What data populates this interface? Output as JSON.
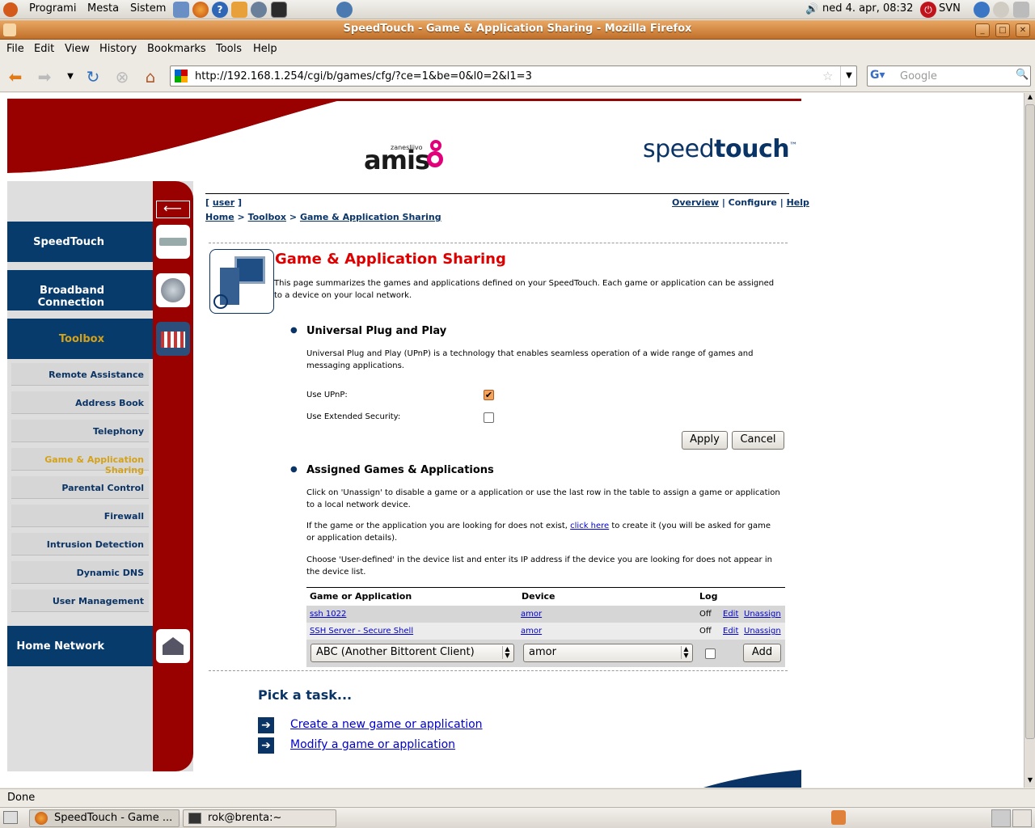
{
  "panel": {
    "menus": [
      "Programi",
      "Mesta",
      "Sistem"
    ],
    "clock": "ned  4. apr, 08:32",
    "svn": "SVN"
  },
  "window": {
    "title": "SpeedTouch - Game & Application Sharing - Mozilla Firefox"
  },
  "menubar": [
    "File",
    "Edit",
    "View",
    "History",
    "Bookmarks",
    "Tools",
    "Help"
  ],
  "toolbar": {
    "url": "http://192.168.1.254/cgi/b/games/cfg/?ce=1&be=0&l0=2&l1=3",
    "search_placeholder": "Google"
  },
  "brand": {
    "partner_small": "zanesljivo",
    "partner": "amis",
    "product_light": "speed",
    "product_bold": "touch",
    "tm": "™"
  },
  "sidebar": {
    "main": [
      "SpeedTouch",
      "Broadband Connection",
      "Toolbox",
      "Home Network"
    ],
    "sub": [
      "Remote Assistance",
      "Address Book",
      "Telephony",
      "Game & Application Sharing",
      "Parental Control",
      "Firewall",
      "Intrusion Detection",
      "Dynamic DNS",
      "User Management"
    ]
  },
  "header": {
    "user": "user",
    "overview": "Overview",
    "configure": "Configure",
    "help": "Help",
    "crumbs": [
      "Home",
      "Toolbox",
      "Game & Application Sharing"
    ]
  },
  "page": {
    "title": "Game & Application Sharing",
    "intro": "This page summarizes the games and applications defined on your SpeedTouch. Each game or application can be assigned to a device on your local network.",
    "upnp_heading": "Universal Plug and Play",
    "upnp_text": "Universal Plug and Play (UPnP) is a technology that enables seamless operation of a wide range of games and messaging applications.",
    "use_upnp_label": "Use UPnP:",
    "use_upnp_checked": true,
    "ext_sec_label": "Use Extended Security:",
    "ext_sec_checked": false,
    "apply": "Apply",
    "cancel": "Cancel",
    "assigned_heading": "Assigned Games & Applications",
    "assigned_text1": "Click on 'Unassign' to disable a game or a application or use the last row in the table to assign a game or application to a local network device.",
    "assigned_text2_pre": "If the game or the application you are looking for does not exist,",
    "assigned_text2_link": "click here",
    "assigned_text2_post": "to create it (you will be asked for game or application details).",
    "assigned_text3": "Choose 'User-defined' in the device list and enter its IP address if the device you are looking for does not appear in the device list."
  },
  "table": {
    "headers": [
      "Game or Application",
      "Device",
      "Log"
    ],
    "rows": [
      {
        "app": "ssh 1022",
        "device": "amor",
        "log": "Off",
        "edit": "Edit",
        "unassign": "Unassign"
      },
      {
        "app": "SSH Server - Secure Shell",
        "device": "amor",
        "log": "Off",
        "edit": "Edit",
        "unassign": "Unassign"
      }
    ],
    "new_app": "ABC (Another Bittorent Client)",
    "new_device": "amor",
    "add": "Add"
  },
  "tasks": {
    "heading": "Pick a task...",
    "items": [
      "Create a new game or application",
      "Modify a game or application"
    ]
  },
  "status": "Done",
  "taskbar": [
    "SpeedTouch - Game ...",
    "rok@brenta:~"
  ],
  "colors": {
    "navy": "#073b6c",
    "red": "#990000",
    "title_red": "#dd0000",
    "active_gold": "#d4a21a"
  }
}
